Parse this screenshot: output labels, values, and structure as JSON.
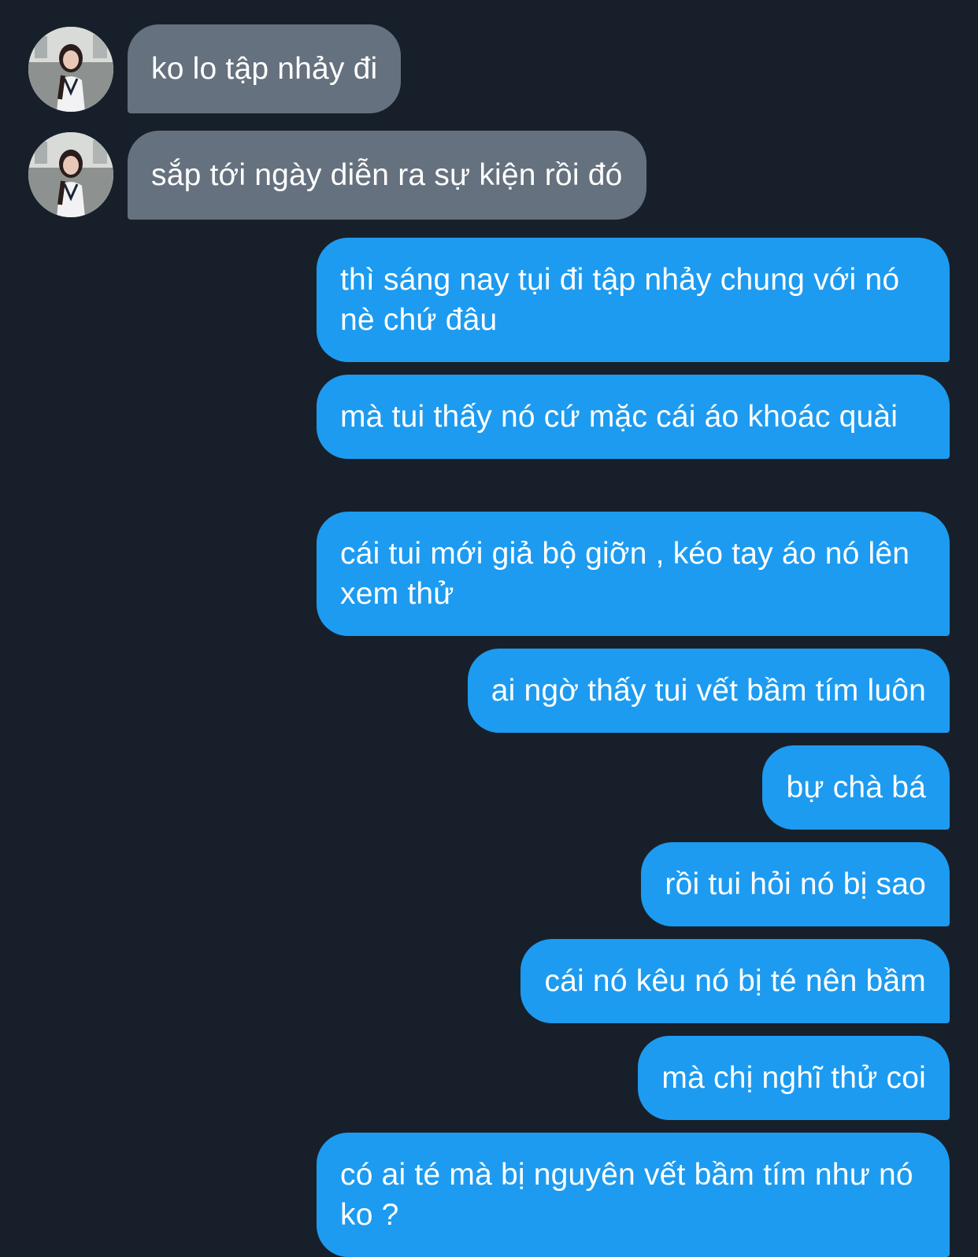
{
  "conversation": {
    "incoming": [
      {
        "text": "ko lo tập nhảy đi"
      },
      {
        "text": "sắp tới ngày diễn ra sự kiện rồi đó"
      }
    ],
    "outgoing": [
      {
        "text": "thì sáng nay tụi đi tập nhảy chung với nó nè chứ đâu"
      },
      {
        "text": "mà tui thấy nó cứ mặc cái áo khoác quài"
      },
      {
        "text": "cái tui mới giả bộ giỡn , kéo tay áo nó lên xem thử"
      },
      {
        "text": "ai ngờ thấy tui vết bầm tím luôn"
      },
      {
        "text": "bự chà bá"
      },
      {
        "text": "rồi tui hỏi nó bị sao"
      },
      {
        "text": "cái nó kêu nó bị té nên bầm"
      },
      {
        "text": "mà chị nghĩ thử coi"
      },
      {
        "text": "có ai té mà bị nguyên vết bầm tím như nó ko ?"
      }
    ]
  },
  "colors": {
    "background": "#17202a",
    "incoming_bubble": "#65717e",
    "outgoing_bubble": "#1d9bf0",
    "text": "#ffffff"
  },
  "icons": {
    "avatar": "contact-avatar-photo"
  }
}
